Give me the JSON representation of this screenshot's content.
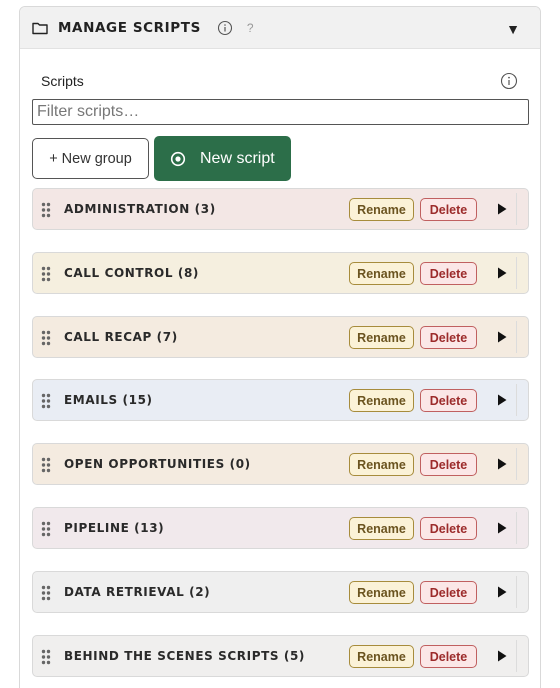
{
  "panel": {
    "title": "MANAGE SCRIPTS",
    "help": "?",
    "collapse_glyph": "▼",
    "icons": {
      "folder": "folder-icon",
      "info": "info-icon",
      "help": "help-icon",
      "collapse": "collapse-triangle-icon"
    }
  },
  "scripts": {
    "label": "Scripts",
    "filter_placeholder": "Filter scripts…",
    "new_group_label": "+ New group",
    "new_script_label": "New script"
  },
  "groups": [
    {
      "name": "ADMINISTRATION (3)",
      "bg": "#f3e7e5"
    },
    {
      "name": "CALL CONTROL (8)",
      "bg": "#f5efdf"
    },
    {
      "name": "CALL RECAP (7)",
      "bg": "#f4ebe0"
    },
    {
      "name": "EMAILS (15)",
      "bg": "#e9edf4"
    },
    {
      "name": "OPEN OPPORTUNITIES (0)",
      "bg": "#f4ebe0"
    },
    {
      "name": "PIPELINE (13)",
      "bg": "#f1e9ec"
    },
    {
      "name": "DATA RETRIEVAL (2)",
      "bg": "#efefef"
    },
    {
      "name": "BEHIND THE SCENES SCRIPTS (5)",
      "bg": "#f0efee"
    }
  ],
  "row_buttons": {
    "rename": "Rename",
    "delete": "Delete"
  },
  "colors": {
    "primary": "#2c6e49",
    "rename_border": "#a78c3c",
    "delete_border": "#c06060"
  }
}
